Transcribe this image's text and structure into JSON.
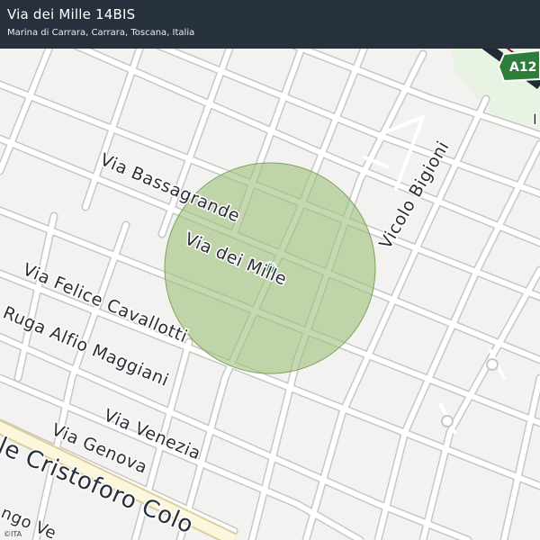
{
  "header": {
    "title": "Via dei Mille 14BIS",
    "subtitle": "Marina di Carrara, Carrara, Toscana, Italia"
  },
  "map": {
    "colors": {
      "background": "#f3f2f1",
      "road": "#ffffff",
      "road_outline": "#c9c7c4",
      "highway": "#1f2a35",
      "park": "#e8f3e4",
      "accuracy_circle": "#9dbf7a",
      "pin": "#2e7d32"
    },
    "street_labels": {
      "bassagrande": "Via Bassagrande",
      "dei_mille": "Via dei Mille",
      "bigioni": "Vicolo Bigioni",
      "cavallotti": "Via Felice Cavallotti",
      "maggiani": "Ruga Alfio Maggiani",
      "venezia": "Via Venezia",
      "genova": "Via Genova",
      "colombo": "le Cristoforo Colo",
      "corner": "ngo Ve"
    },
    "highway_shield": "A12",
    "partial_label_right": "I"
  },
  "attribution": "©ITA"
}
